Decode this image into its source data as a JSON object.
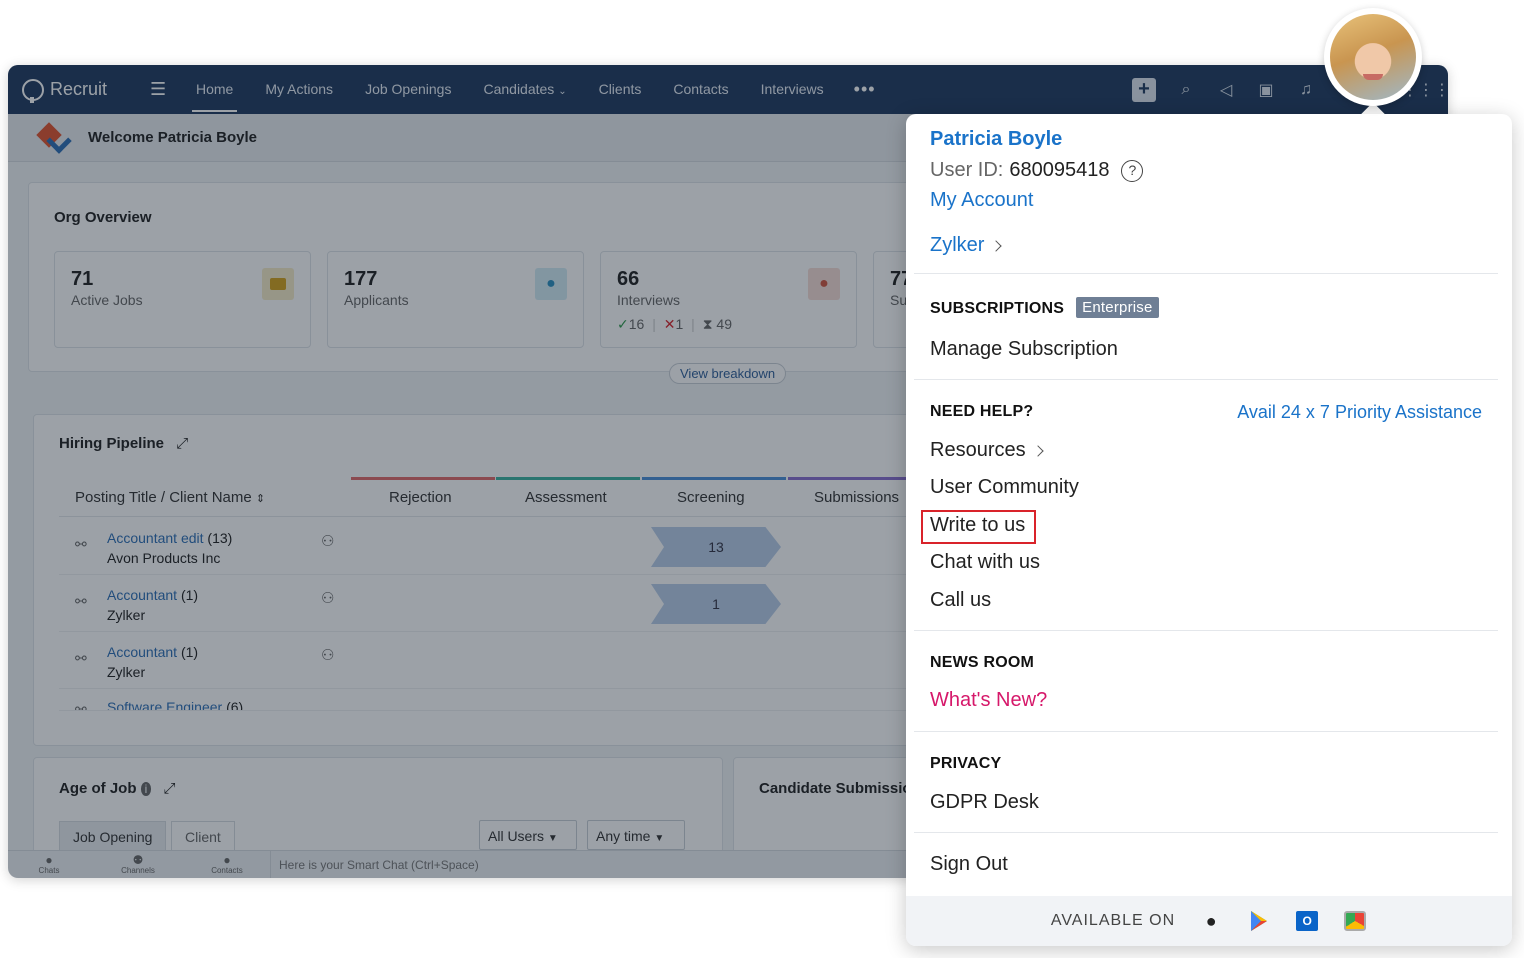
{
  "app": {
    "brand": "Recruit",
    "nav": [
      "Home",
      "My Actions",
      "Job Openings",
      "Candidates",
      "Clients",
      "Contacts",
      "Interviews"
    ],
    "nav_more": "•••",
    "welcome": "Welcome Patricia Boyle"
  },
  "org_overview": {
    "title": "Org Overview",
    "stats": [
      {
        "num": "71",
        "label": "Active Jobs"
      },
      {
        "num": "177",
        "label": "Applicants"
      },
      {
        "num": "66",
        "label": "Interviews",
        "sub": [
          "16",
          "1",
          "49"
        ]
      },
      {
        "num": "77",
        "label": "Su"
      }
    ],
    "view_breakdown": "View breakdown"
  },
  "pipeline": {
    "title": "Hiring Pipeline",
    "col_title": "Posting Title / Client Name",
    "stages": [
      "Rejection",
      "Assessment",
      "Screening",
      "Submissions"
    ],
    "stage_colors": [
      "#e26a6a",
      "#3bb3a0",
      "#4a90d9",
      "#8a6fd1"
    ],
    "rows": [
      {
        "title": "Accountant edit",
        "count": "(13)",
        "client": "Avon Products Inc",
        "screening": "13"
      },
      {
        "title": "Accountant",
        "count": "(1)",
        "client": "Zylker",
        "screening": "1"
      },
      {
        "title": "Accountant",
        "count": "(1)",
        "client": "Zylker",
        "screening": ""
      },
      {
        "title": "Software Engineer",
        "count": "(6)",
        "client": "",
        "screening": ""
      }
    ]
  },
  "age_of_job": {
    "title": "Age of Job",
    "tabs": [
      "Job Opening",
      "Client"
    ],
    "dd_users": "All Users",
    "dd_time": "Any time"
  },
  "cand_sub": {
    "title": "Candidate Submissio"
  },
  "smartbar": {
    "items": [
      "Chats",
      "Channels",
      "Contacts"
    ],
    "placeholder": "Here is your Smart Chat (Ctrl+Space)"
  },
  "profile": {
    "name": "Patricia Boyle",
    "user_id_label": "User ID:",
    "user_id": "680095418",
    "my_account": "My Account",
    "org": "Zylker",
    "subscriptions_head": "SUBSCRIPTIONS",
    "plan_badge": "Enterprise",
    "manage_subscription": "Manage Subscription",
    "help_head": "NEED HELP?",
    "priority": "Avail 24 x 7 Priority Assistance",
    "help_items": [
      "Resources",
      "User Community",
      "Write to us",
      "Chat with us",
      "Call us"
    ],
    "news_head": "NEWS ROOM",
    "whats_new": "What's New?",
    "privacy_head": "PRIVACY",
    "gdpr": "GDPR Desk",
    "sign_out": "Sign Out",
    "available_on": "AVAILABLE ON",
    "stores": [
      "apple-icon",
      "google-play-icon",
      "outlook-icon",
      "chrome-store-icon"
    ]
  }
}
